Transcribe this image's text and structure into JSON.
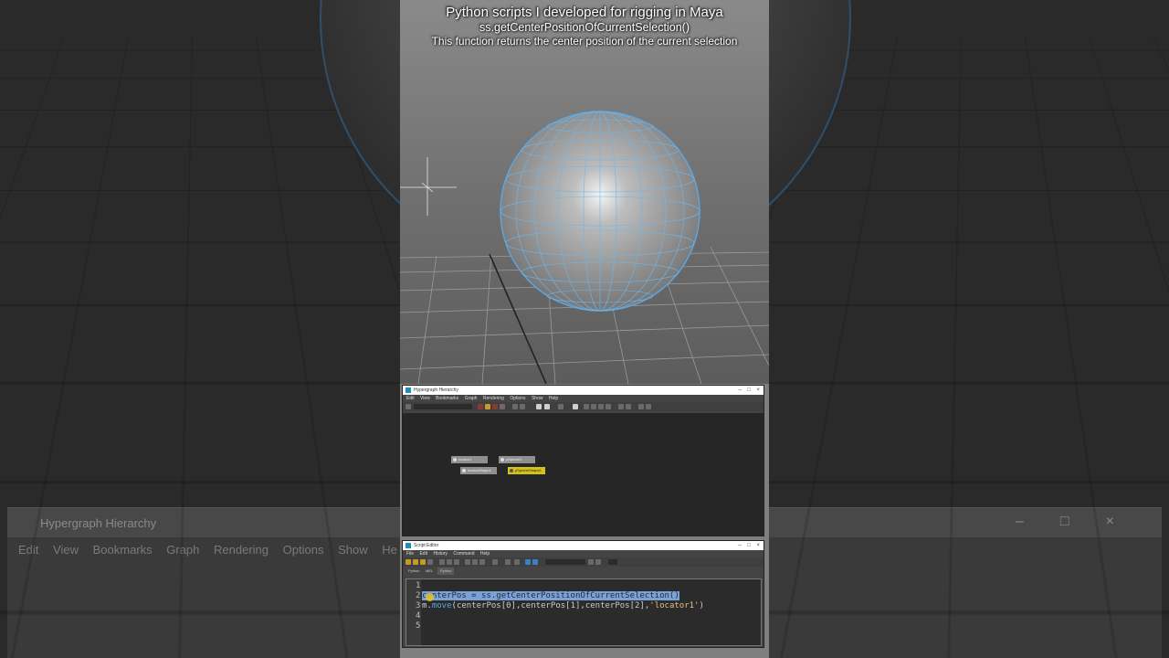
{
  "caption": {
    "line1": "Python scripts I developed for rigging in Maya",
    "line2": "ss.getCenterPositionOfCurrentSelection()",
    "line3": "This function returns the center position of the current selection"
  },
  "background": {
    "left_window_title": "Hypergraph Hierarchy",
    "left_menu": [
      "Edit",
      "View",
      "Bookmarks",
      "Graph",
      "Rendering",
      "Options",
      "Show",
      "He"
    ]
  },
  "hypergraph": {
    "title": "Hypergraph Hierarchy",
    "controls": [
      "–",
      "□",
      "×"
    ],
    "menu": [
      "Edit",
      "View",
      "Bookmarks",
      "Graph",
      "Rendering",
      "Options",
      "Show",
      "Help"
    ],
    "nodes": [
      {
        "label": "locator1"
      },
      {
        "label": "pSphere1"
      },
      {
        "label": "locatorShape1"
      },
      {
        "label": "pSphereShape1"
      }
    ]
  },
  "script_editor": {
    "title": "Script Editor",
    "controls": [
      "–",
      "□",
      "×"
    ],
    "menu": [
      "File",
      "Edit",
      "History",
      "Command",
      "Help"
    ],
    "tabs": [
      "Python",
      "MEL",
      "Python"
    ],
    "active_tab_index": 2,
    "line_numbers": [
      "1",
      "2",
      "3",
      "4",
      "5"
    ],
    "code": {
      "line2": "centerPos = ss.getCenterPositionOfCurrentSelection()",
      "line3_prefix": "m.",
      "line3_func": "move",
      "line3_args": "(centerPos[0],centerPos[1],centerPos[2],",
      "line3_str": "'locator1'",
      "line3_end": ")"
    }
  },
  "colors": {
    "selection_highlight": "#7aa2d6",
    "wireframe": "#5aa9e6",
    "selected_node": "#d4c21a",
    "viewport_bg": "#7f7f7f"
  }
}
